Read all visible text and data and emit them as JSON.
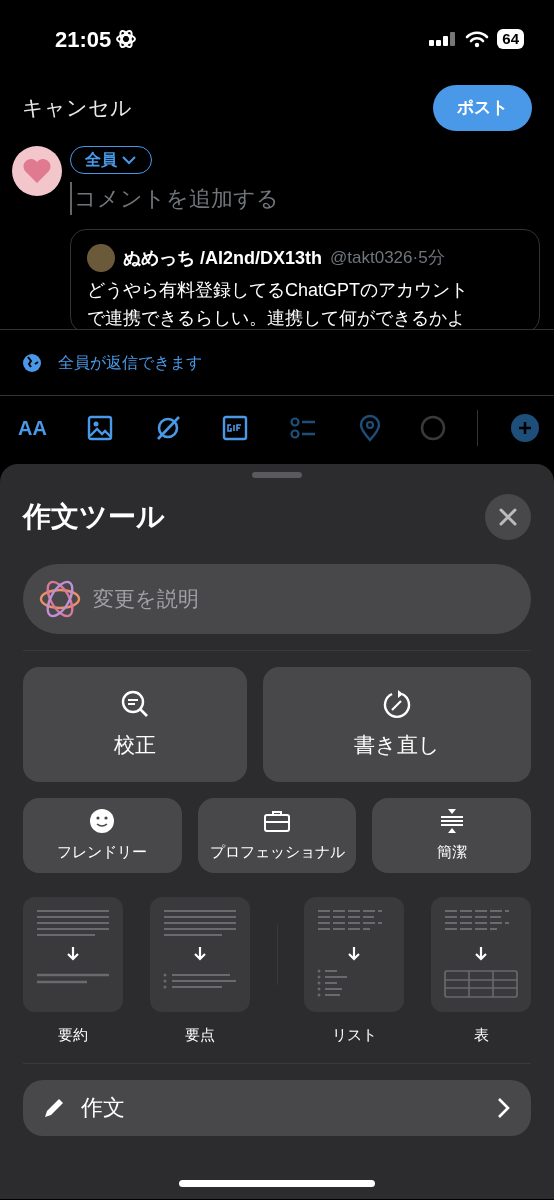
{
  "status_bar": {
    "time": "21:05",
    "battery": "64"
  },
  "nav": {
    "cancel": "キャンセル",
    "post": "ポスト"
  },
  "audience": {
    "label": "全員"
  },
  "compose": {
    "placeholder": "コメントを追加する"
  },
  "quote": {
    "name": "ぬめっち /AI2nd/DX13th",
    "handle": "@takt0326",
    "separator": "·",
    "time": "5分",
    "lines": [
      "どうやら有料登録してるChatGPTのアカウント",
      "で連携できるらしい。連携して何ができるかよ"
    ]
  },
  "reply_setting": "全員が返信できます",
  "toolbar": [
    {
      "kind": "text-size",
      "label": "AA",
      "disabled": false
    },
    {
      "kind": "image",
      "disabled": false
    },
    {
      "kind": "grok",
      "disabled": false
    },
    {
      "kind": "gif",
      "disabled": false
    },
    {
      "kind": "poll",
      "disabled": true
    },
    {
      "kind": "location",
      "disabled": true
    }
  ],
  "sheet": {
    "title": "作文ツール",
    "describe_placeholder": "変更を説明",
    "main_actions": [
      {
        "kind": "proofread",
        "label": "校正"
      },
      {
        "kind": "rewrite",
        "label": "書き直し"
      }
    ],
    "tones": [
      {
        "kind": "friendly",
        "label": "フレンドリー"
      },
      {
        "kind": "professional",
        "label": "プロフェッショナル"
      },
      {
        "kind": "concise",
        "label": "簡潔"
      }
    ],
    "formats": [
      {
        "kind": "summary",
        "label": "要約"
      },
      {
        "kind": "keypoints",
        "label": "要点"
      },
      {
        "kind": "list",
        "label": "リスト"
      },
      {
        "kind": "table",
        "label": "表"
      }
    ],
    "compose": "作文"
  }
}
